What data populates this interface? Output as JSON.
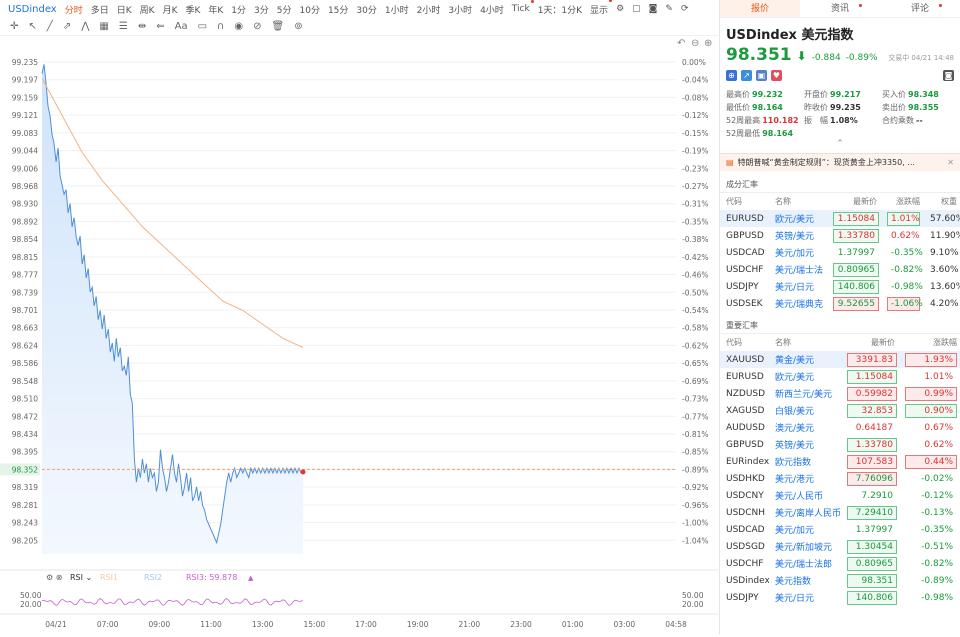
{
  "toolbar": {
    "symbol": "USDindex",
    "periods": [
      "分时",
      "多日",
      "日K",
      "周K",
      "月K",
      "季K",
      "年K",
      "1分",
      "3分",
      "5分",
      "10分",
      "15分",
      "30分",
      "1小时",
      "2小时",
      "3小时",
      "4小时",
      "Tick",
      "1天：1分K",
      "显示"
    ]
  },
  "chart": {
    "left_ticks": [
      "99.235",
      "99.197",
      "99.159",
      "99.121",
      "99.083",
      "99.044",
      "99.006",
      "98.968",
      "98.930",
      "98.892",
      "98.854",
      "98.815",
      "98.777",
      "98.739",
      "98.701",
      "98.663",
      "98.624",
      "98.586",
      "98.548",
      "98.510",
      "98.472",
      "98.434",
      "98.395",
      "98.352",
      "98.319",
      "98.281",
      "98.243",
      "98.205"
    ],
    "right_ticks": [
      "0.00%",
      "-0.04%",
      "-0.08%",
      "-0.12%",
      "-0.15%",
      "-0.19%",
      "-0.23%",
      "-0.27%",
      "-0.31%",
      "-0.35%",
      "-0.38%",
      "-0.42%",
      "-0.46%",
      "-0.50%",
      "-0.54%",
      "-0.58%",
      "-0.62%",
      "-0.65%",
      "-0.69%",
      "-0.73%",
      "-0.77%",
      "-0.81%",
      "-0.85%",
      "-0.89%",
      "-0.92%",
      "-0.96%",
      "-1.00%",
      "-1.04%"
    ],
    "current_price": "98.352",
    "current_pct": "-0.89%",
    "time_labels": [
      "04/21",
      "07:00",
      "09:00",
      "11:00",
      "13:00",
      "15:00",
      "17:00",
      "19:00",
      "21:00",
      "23:00",
      "01:00",
      "03:00",
      "04:58"
    ],
    "rsi_label": "RSI",
    "rsi_p1": "RSI1",
    "rsi_p2": "RSI2",
    "rsi_value": "RSI3: 59.878",
    "rsi_left": [
      "50.00",
      "20.00"
    ],
    "rsi_right": [
      "50.00",
      "20.00"
    ]
  },
  "chart_data": {
    "type": "line",
    "series": [
      {
        "name": "price",
        "x": [
          0,
          2,
          4,
          6,
          8,
          10,
          12,
          14,
          16,
          18,
          20,
          22,
          24,
          26,
          28,
          30,
          32,
          34,
          36,
          38,
          40,
          42,
          44,
          46,
          48,
          50,
          52,
          54,
          56,
          58,
          60,
          62,
          64,
          66,
          68,
          70,
          72,
          74,
          76,
          78,
          80,
          82,
          84,
          86,
          88,
          90,
          92,
          94,
          96,
          98,
          100,
          102,
          104,
          106,
          108,
          110,
          112,
          114,
          116,
          118,
          120,
          122,
          124,
          126,
          128,
          130,
          132,
          134,
          136,
          138,
          140,
          142,
          144,
          146,
          148,
          150,
          152,
          154,
          156,
          158,
          160,
          162,
          164,
          166,
          168,
          170,
          172,
          174,
          176,
          178,
          180,
          182,
          184,
          186,
          188,
          190,
          192,
          194,
          196,
          198,
          200,
          202,
          204,
          206,
          208,
          210,
          212,
          214,
          216,
          218,
          220,
          222,
          224,
          226,
          228,
          230,
          232,
          234,
          236,
          238,
          240,
          242,
          244,
          246,
          248,
          250,
          252,
          254,
          256,
          258,
          260
        ],
        "values": [
          99.21,
          99.23,
          99.19,
          99.14,
          99.12,
          99.08,
          99.06,
          99.02,
          99.05,
          98.99,
          98.97,
          98.95,
          98.96,
          98.91,
          98.93,
          98.88,
          98.9,
          98.86,
          98.84,
          98.86,
          98.8,
          98.82,
          98.77,
          98.79,
          98.74,
          98.75,
          98.71,
          98.73,
          98.68,
          98.7,
          98.66,
          98.69,
          98.64,
          98.66,
          98.61,
          98.63,
          98.59,
          98.64,
          98.6,
          98.62,
          98.57,
          98.58,
          98.56,
          98.6,
          98.52,
          98.5,
          98.38,
          98.33,
          98.36,
          98.34,
          98.38,
          98.35,
          98.37,
          98.33,
          98.36,
          98.34,
          98.35,
          98.31,
          98.33,
          98.4,
          98.36,
          98.34,
          98.31,
          98.33,
          98.36,
          98.39,
          98.35,
          98.33,
          98.37,
          98.34,
          98.3,
          98.32,
          98.35,
          98.31,
          98.34,
          98.29,
          98.3,
          98.32,
          98.29,
          98.31,
          98.28,
          98.27,
          98.25,
          98.24,
          98.23,
          98.22,
          98.21,
          98.2,
          98.22,
          98.24,
          98.27,
          98.3,
          98.33,
          98.35,
          98.33,
          98.35,
          98.36,
          98.34,
          98.35,
          98.36,
          98.35,
          98.36,
          98.35,
          98.34,
          98.36,
          98.35,
          98.36,
          98.35,
          98.36,
          98.35,
          98.36,
          98.35,
          98.36,
          98.35,
          98.36,
          98.35,
          98.36,
          98.35,
          98.36,
          98.35,
          98.36,
          98.35,
          98.36,
          98.35,
          98.36,
          98.35,
          98.36,
          98.35,
          98.36,
          98.35,
          98.352
        ]
      },
      {
        "name": "avg",
        "x": [
          0,
          20,
          40,
          60,
          80,
          100,
          120,
          140,
          160,
          180,
          200,
          220,
          240,
          260
        ],
        "values": [
          99.2,
          99.12,
          99.04,
          98.98,
          98.93,
          98.88,
          98.84,
          98.8,
          98.76,
          98.72,
          98.7,
          98.67,
          98.64,
          98.62
        ]
      }
    ],
    "ylim": [
      98.205,
      99.235
    ]
  },
  "side": {
    "tabs": [
      "报价",
      "资讯",
      "评论"
    ],
    "name": "USDindex 美元指数",
    "price": "98.351",
    "arrow": "⬇",
    "change": "-0.884",
    "change_pct": "-0.89%",
    "timestamp": "交易中 04/21 14:48",
    "stats": [
      [
        "最高价",
        "99.232",
        "g"
      ],
      [
        "开盘价",
        "99.217",
        "g"
      ],
      [
        "买入价",
        "98.348",
        "g"
      ],
      [
        "最低价",
        "98.164",
        "g"
      ],
      [
        "昨收价",
        "99.235",
        "n"
      ],
      [
        "卖出价",
        "98.355",
        "g"
      ],
      [
        "52周最高",
        "110.182",
        "r"
      ],
      [
        "振　幅",
        "1.08%",
        "n"
      ],
      [
        "合约乘数",
        "--",
        "n"
      ],
      [
        "52周最低",
        "98.164",
        "g"
      ],
      [
        "",
        "",
        "n"
      ],
      [
        "",
        "",
        "n"
      ]
    ],
    "news": "特朗普喊“黄金制定规则”：现货黄金上冲3350, ...",
    "section1": "成分汇率",
    "section2": "重要汇率",
    "cols1": [
      "代码",
      "名称",
      "最新价",
      "涨跌幅",
      "权重"
    ],
    "cols2": [
      "代码",
      "名称",
      "最新价",
      "涨跌幅"
    ],
    "comp": [
      [
        "EURUSD",
        "欧元/美元",
        "1.15084",
        "1.01%",
        "57.60%",
        "up",
        "g",
        "g",
        true
      ],
      [
        "GBPUSD",
        "英镑/美元",
        "1.33780",
        "0.62%",
        "11.90%",
        "up",
        "g",
        "",
        false
      ],
      [
        "USDCAD",
        "美元/加元",
        "1.37997",
        "-0.35%",
        "9.10%",
        "dn",
        "",
        "",
        false
      ],
      [
        "USDCHF",
        "美元/瑞士法",
        "0.80965",
        "-0.82%",
        "3.60%",
        "dn",
        "g",
        "",
        false
      ],
      [
        "USDJPY",
        "美元/日元",
        "140.806",
        "-0.98%",
        "13.60%",
        "dn",
        "g",
        "",
        false
      ],
      [
        "USDSEK",
        "美元/瑞典克",
        "9.52655",
        "-1.06%",
        "4.20%",
        "dn",
        "r",
        "r",
        false
      ]
    ],
    "major": [
      [
        "XAUUSD",
        "黄金/美元",
        "3391.83",
        "1.93%",
        "up",
        "r",
        "r",
        true
      ],
      [
        "EURUSD",
        "欧元/美元",
        "1.15084",
        "1.01%",
        "up",
        "g",
        "",
        false
      ],
      [
        "NZDUSD",
        "新西兰元/美元",
        "0.59982",
        "0.99%",
        "up",
        "r",
        "r",
        false
      ],
      [
        "XAGUSD",
        "白银/美元",
        "32.853",
        "0.90%",
        "up",
        "g",
        "g",
        false
      ],
      [
        "AUDUSD",
        "澳元/美元",
        "0.64187",
        "0.67%",
        "up",
        "",
        "",
        false
      ],
      [
        "GBPUSD",
        "英镑/美元",
        "1.33780",
        "0.62%",
        "up",
        "g",
        "",
        false
      ],
      [
        "EURindex",
        "欧元指数",
        "107.583",
        "0.44%",
        "up",
        "r",
        "r",
        false
      ],
      [
        "USDHKD",
        "美元/港元",
        "7.76096",
        "-0.02%",
        "dn",
        "r",
        "",
        false
      ],
      [
        "USDCNY",
        "美元/人民币",
        "7.2910",
        "-0.12%",
        "dn",
        "",
        "",
        false
      ],
      [
        "USDCNH",
        "美元/离岸人民币",
        "7.29410",
        "-0.13%",
        "dn",
        "g",
        "",
        false
      ],
      [
        "USDCAD",
        "美元/加元",
        "1.37997",
        "-0.35%",
        "dn",
        "",
        "",
        false
      ],
      [
        "USDSGD",
        "美元/新加坡元",
        "1.30454",
        "-0.51%",
        "dn",
        "g",
        "",
        false
      ],
      [
        "USDCHF",
        "美元/瑞士法郎",
        "0.80965",
        "-0.82%",
        "dn",
        "g",
        "",
        false
      ],
      [
        "USDindex",
        "美元指数",
        "98.351",
        "-0.89%",
        "dn",
        "g",
        "",
        false
      ],
      [
        "USDJPY",
        "美元/日元",
        "140.806",
        "-0.98%",
        "dn",
        "g",
        "",
        false
      ]
    ]
  }
}
